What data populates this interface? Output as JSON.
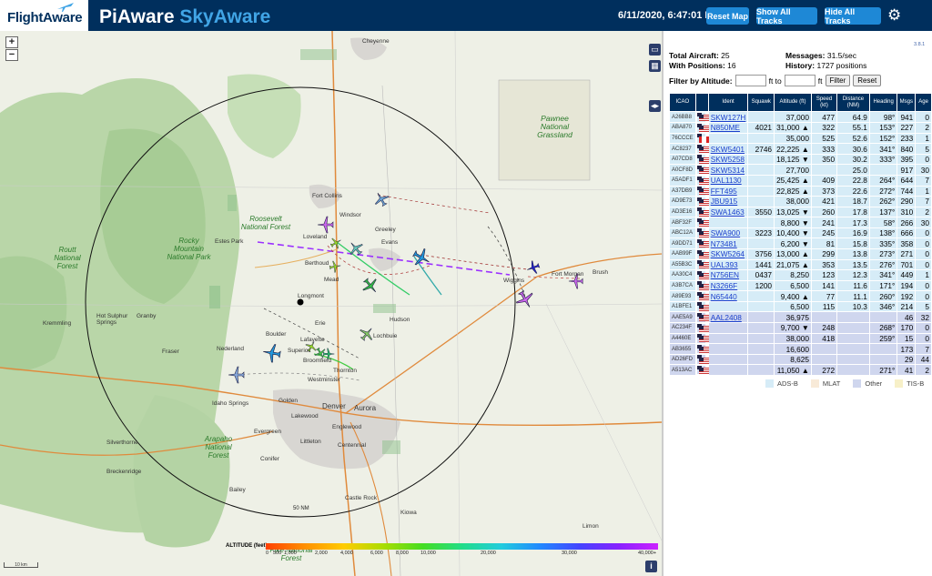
{
  "header": {
    "brand": "FlightAware",
    "app_title_a": "PiAware",
    "app_title_b": "SkyAware",
    "clock": "6/11/2020, 6:47:01 PM",
    "reset_map": "Reset Map",
    "show_all": "Show All Tracks",
    "hide_all": "Hide All Tracks"
  },
  "sidebar": {
    "version": "3.8.1",
    "total_label": "Total Aircraft:",
    "total": "25",
    "pos_label": "With Positions:",
    "positions": "16",
    "msg_label": "Messages:",
    "messages": "31.5/sec",
    "hist_label": "History:",
    "history": "1727 positions",
    "filter_label": "Filter by Altitude:",
    "ft_to": "ft to",
    "ft": "ft",
    "filter_btn": "Filter",
    "reset_btn": "Reset"
  },
  "table": {
    "headers": [
      "ICAO",
      "",
      "Ident",
      "Squawk",
      "Altitude (ft)",
      "Speed (kt)",
      "Distance (NM)",
      "Heading",
      "Msgs",
      "Age"
    ],
    "rows": [
      {
        "icao": "A26BB8",
        "flag": "us",
        "ident": "SKW127H",
        "squawk": "",
        "alt": "37,000",
        "spd": "477",
        "dist": "64.9",
        "hdg": "98°",
        "msgs": "941",
        "age": "0",
        "cls": "adsb"
      },
      {
        "icao": "ABA870",
        "flag": "us",
        "ident": "N850ME",
        "squawk": "4021",
        "alt": "31,000 ▲",
        "spd": "322",
        "dist": "55.1",
        "hdg": "153°",
        "msgs": "227",
        "age": "2",
        "cls": "adsb"
      },
      {
        "icao": "76CCCE",
        "flag": "can",
        "ident": "",
        "squawk": "",
        "alt": "35,000",
        "spd": "525",
        "dist": "52.6",
        "hdg": "152°",
        "msgs": "233",
        "age": "1",
        "cls": "adsb"
      },
      {
        "icao": "AC8237",
        "flag": "us",
        "ident": "SKW5401",
        "squawk": "2746",
        "alt": "22,225 ▲",
        "spd": "333",
        "dist": "30.6",
        "hdg": "341°",
        "msgs": "840",
        "age": "5",
        "cls": "adsb"
      },
      {
        "icao": "A07CD8",
        "flag": "us",
        "ident": "SKW5258",
        "squawk": "",
        "alt": "18,125 ▼",
        "spd": "350",
        "dist": "30.2",
        "hdg": "333°",
        "msgs": "395",
        "age": "0",
        "cls": "adsb"
      },
      {
        "icao": "A0CF8D",
        "flag": "us",
        "ident": "SKW5314",
        "squawk": "",
        "alt": "27,700",
        "spd": "",
        "dist": "25.0",
        "hdg": "",
        "msgs": "917",
        "age": "30",
        "cls": "adsb"
      },
      {
        "icao": "A5ADF1",
        "flag": "us",
        "ident": "UAL1130",
        "squawk": "",
        "alt": "25,425 ▲",
        "spd": "409",
        "dist": "22.8",
        "hdg": "264°",
        "msgs": "644",
        "age": "7",
        "cls": "adsb"
      },
      {
        "icao": "A37DB9",
        "flag": "us",
        "ident": "FFT495",
        "squawk": "",
        "alt": "22,825 ▲",
        "spd": "373",
        "dist": "22.6",
        "hdg": "272°",
        "msgs": "744",
        "age": "1",
        "cls": "adsb"
      },
      {
        "icao": "AD9E73",
        "flag": "us",
        "ident": "JBU915",
        "squawk": "",
        "alt": "38,000",
        "spd": "421",
        "dist": "18.7",
        "hdg": "262°",
        "msgs": "290",
        "age": "7",
        "cls": "adsb"
      },
      {
        "icao": "AD3E16",
        "flag": "us",
        "ident": "SWA1463",
        "squawk": "3550",
        "alt": "13,025 ▼",
        "spd": "260",
        "dist": "17.8",
        "hdg": "137°",
        "msgs": "310",
        "age": "2",
        "cls": "adsb"
      },
      {
        "icao": "ABF32F",
        "flag": "us",
        "ident": "",
        "squawk": "",
        "alt": "8,800 ▼",
        "spd": "241",
        "dist": "17.3",
        "hdg": "58°",
        "msgs": "266",
        "age": "30",
        "cls": "adsb"
      },
      {
        "icao": "ABC12A",
        "flag": "us",
        "ident": "SWA900",
        "squawk": "3223",
        "alt": "10,400 ▼",
        "spd": "245",
        "dist": "16.9",
        "hdg": "138°",
        "msgs": "666",
        "age": "0",
        "cls": "adsb"
      },
      {
        "icao": "A9DD71",
        "flag": "us",
        "ident": "N73481",
        "squawk": "",
        "alt": "6,200 ▼",
        "spd": "81",
        "dist": "15.8",
        "hdg": "335°",
        "msgs": "358",
        "age": "0",
        "cls": "adsb"
      },
      {
        "icao": "AAB99F",
        "flag": "us",
        "ident": "SKW5264",
        "squawk": "3756",
        "alt": "13,000 ▲",
        "spd": "299",
        "dist": "13.8",
        "hdg": "273°",
        "msgs": "271",
        "age": "0",
        "cls": "adsb"
      },
      {
        "icao": "A55B3C",
        "flag": "us",
        "ident": "UAL393",
        "squawk": "1441",
        "alt": "21,075 ▲",
        "spd": "353",
        "dist": "13.5",
        "hdg": "276°",
        "msgs": "701",
        "age": "0",
        "cls": "adsb"
      },
      {
        "icao": "AA30C4",
        "flag": "us",
        "ident": "N756EN",
        "squawk": "0437",
        "alt": "8,250",
        "spd": "123",
        "dist": "12.3",
        "hdg": "341°",
        "msgs": "449",
        "age": "1",
        "cls": "adsb"
      },
      {
        "icao": "A3B7CA",
        "flag": "us",
        "ident": "N3266F",
        "squawk": "1200",
        "alt": "6,500",
        "spd": "141",
        "dist": "11.6",
        "hdg": "171°",
        "msgs": "194",
        "age": "0",
        "cls": "adsb"
      },
      {
        "icao": "A89E93",
        "flag": "us",
        "ident": "N65440",
        "squawk": "",
        "alt": "9,400 ▲",
        "spd": "77",
        "dist": "11.1",
        "hdg": "260°",
        "msgs": "192",
        "age": "0",
        "cls": "adsb"
      },
      {
        "icao": "A1BFE1",
        "flag": "us",
        "ident": "",
        "squawk": "",
        "alt": "6,500",
        "spd": "115",
        "dist": "10.3",
        "hdg": "346°",
        "msgs": "214",
        "age": "5",
        "cls": "adsb"
      },
      {
        "icao": "AAE5A9",
        "flag": "us",
        "ident": "AAL2408",
        "squawk": "",
        "alt": "36,975",
        "spd": "",
        "dist": "",
        "hdg": "",
        "msgs": "46",
        "age": "32",
        "cls": "other"
      },
      {
        "icao": "AC234F",
        "flag": "us",
        "ident": "",
        "squawk": "",
        "alt": "9,700 ▼",
        "spd": "248",
        "dist": "",
        "hdg": "268°",
        "msgs": "170",
        "age": "0",
        "cls": "other"
      },
      {
        "icao": "A4460E",
        "flag": "us",
        "ident": "",
        "squawk": "",
        "alt": "38,000",
        "spd": "418",
        "dist": "",
        "hdg": "259°",
        "msgs": "15",
        "age": "0",
        "cls": "other"
      },
      {
        "icao": "AB3655",
        "flag": "us",
        "ident": "",
        "squawk": "",
        "alt": "16,600",
        "spd": "",
        "dist": "",
        "hdg": "",
        "msgs": "173",
        "age": "7",
        "cls": "other"
      },
      {
        "icao": "AD26FD",
        "flag": "us",
        "ident": "",
        "squawk": "",
        "alt": "8,625",
        "spd": "",
        "dist": "",
        "hdg": "",
        "msgs": "29",
        "age": "44",
        "cls": "other"
      },
      {
        "icao": "A513AC",
        "flag": "us",
        "ident": "",
        "squawk": "",
        "alt": "11,050 ▲",
        "spd": "272",
        "dist": "",
        "hdg": "271°",
        "msgs": "41",
        "age": "2",
        "cls": "other"
      }
    ]
  },
  "legend": [
    {
      "label": "ADS-B",
      "color": "#d6ecf7"
    },
    {
      "label": "MLAT",
      "color": "#f8ead8"
    },
    {
      "label": "Other",
      "color": "#cfd6ee"
    },
    {
      "label": "TIS-B",
      "color": "#f7f0c8"
    }
  ],
  "map": {
    "range_label": "50 NM",
    "altitude_label": "ALTITUDE (feet)",
    "alt_ticks": [
      "0",
      "500",
      "1,000",
      "2,000",
      "4,000",
      "6,000",
      "8,000",
      "10,000",
      "20,000",
      "30,000",
      "40,000+"
    ],
    "scale_label": "10 km",
    "places": [
      {
        "name": "Cheyenne",
        "id": "cheyenne"
      },
      {
        "name": "Fort Collins",
        "id": "fortcollins"
      },
      {
        "name": "Windsor",
        "id": "windsor"
      },
      {
        "name": "Greeley",
        "id": "greeley"
      },
      {
        "name": "Evans",
        "id": "evans"
      },
      {
        "name": "Loveland",
        "id": "loveland"
      },
      {
        "name": "Estes Park",
        "id": "estespark"
      },
      {
        "name": "Berthoud",
        "id": "berthoud"
      },
      {
        "name": "Mead",
        "id": "mead"
      },
      {
        "name": "Longmont",
        "id": "longmont"
      },
      {
        "name": "Erie",
        "id": "erie"
      },
      {
        "name": "Hudson",
        "id": "hudson"
      },
      {
        "name": "Lochbuie",
        "id": "lochbuie"
      },
      {
        "name": "Boulder",
        "id": "boulder"
      },
      {
        "name": "Lafayette",
        "id": "lafayette"
      },
      {
        "name": "Superior",
        "id": "superior"
      },
      {
        "name": "Broomfield",
        "id": "broomfield"
      },
      {
        "name": "Thornton",
        "id": "thornton"
      },
      {
        "name": "Westminster",
        "id": "westminster"
      },
      {
        "name": "Nederland",
        "id": "nederland"
      },
      {
        "name": "Golden",
        "id": "golden"
      },
      {
        "name": "Denver",
        "id": "denver"
      },
      {
        "name": "Aurora",
        "id": "aurora"
      },
      {
        "name": "Lakewood",
        "id": "lakewood"
      },
      {
        "name": "Englewood",
        "id": "englewood"
      },
      {
        "name": "Centennial",
        "id": "centennial"
      },
      {
        "name": "Littleton",
        "id": "littleton"
      },
      {
        "name": "Evergreen",
        "id": "evergreen"
      },
      {
        "name": "Idaho Springs",
        "id": "idahosprings"
      },
      {
        "name": "Castle Rock",
        "id": "castlerock"
      },
      {
        "name": "Conifer",
        "id": "conifer"
      },
      {
        "name": "Bailey",
        "id": "bailey"
      },
      {
        "name": "Kremmling",
        "id": "kremmling"
      },
      {
        "name": "Hot Sulphur Springs",
        "id": "hotsulphur"
      },
      {
        "name": "Granby",
        "id": "granby"
      },
      {
        "name": "Fraser",
        "id": "fraser"
      },
      {
        "name": "Silverthorne",
        "id": "silverthorne"
      },
      {
        "name": "Breckenridge",
        "id": "breckenridge"
      },
      {
        "name": "Wiggins",
        "id": "wiggins"
      },
      {
        "name": "Fort Morgan",
        "id": "fortmorgan"
      },
      {
        "name": "Brush",
        "id": "brush"
      },
      {
        "name": "Limon",
        "id": "limon"
      },
      {
        "name": "Kiowa",
        "id": "kiowa"
      }
    ],
    "parks": [
      {
        "name": "Pawnee National Grassland",
        "id": "pawnee"
      },
      {
        "name": "Roosevelt National Forest",
        "id": "roosevelt"
      },
      {
        "name": "Routt National Forest",
        "id": "routt"
      },
      {
        "name": "Rocky Mountain National Park",
        "id": "rmnp"
      },
      {
        "name": "Arapaho National Forest",
        "id": "arapaho"
      },
      {
        "name": "Pike National Forest",
        "id": "pike"
      }
    ]
  }
}
